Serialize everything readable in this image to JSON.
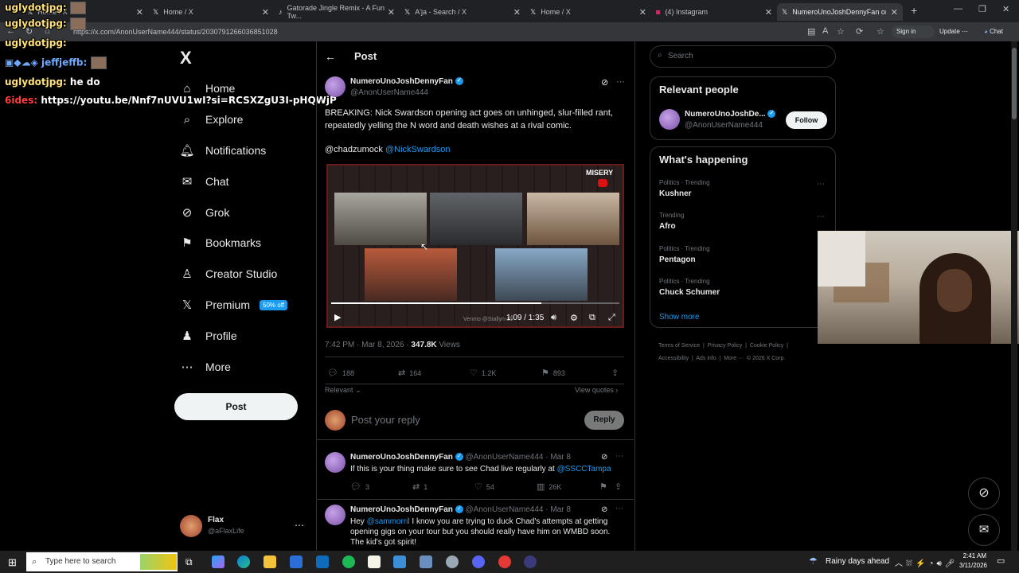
{
  "browser": {
    "tabs": [
      {
        "label": "Home / X",
        "active": false
      },
      {
        "label": "Home / X",
        "active": false
      },
      {
        "label": "Gatorade Jingle Remix - A Fun Tw...",
        "active": false
      },
      {
        "label": "A'ja - Search / X",
        "active": false
      },
      {
        "label": "Home / X",
        "active": false
      },
      {
        "label": "(4) Instagram",
        "active": false
      },
      {
        "label": "NumeroUnoJoshDennyFan on X: \"",
        "active": true
      }
    ],
    "url": "https://x.com/AnonUserName444/status/2030791266036851028",
    "sign_in": "Sign in",
    "update": "Update",
    "chat": "Chat"
  },
  "overlay_chat": [
    {
      "name": "uglydotjpg:",
      "text": "",
      "style": "name"
    },
    {
      "name": "uglydotjpg:",
      "text": "",
      "style": "name"
    },
    {
      "name": "jeffjeffb:",
      "text": "",
      "style": "blue"
    },
    {
      "name": "uglydotjpg:",
      "text": "he do",
      "style": "name"
    },
    {
      "name": "6ides:",
      "text": "https://youtu.be/Nnf7nUVU1wI?si=RCSXZgU3I-pHQWjP",
      "style": "red"
    }
  ],
  "nav": {
    "logo": "X",
    "items": [
      {
        "label": "Home",
        "icon": "home-icon",
        "glyph": "⌂"
      },
      {
        "label": "Explore",
        "icon": "search-icon",
        "glyph": "⌕"
      },
      {
        "label": "Notifications",
        "icon": "bell-icon",
        "glyph": "🔔︎"
      },
      {
        "label": "Chat",
        "icon": "mail-icon",
        "glyph": "✉"
      },
      {
        "label": "Grok",
        "icon": "grok-icon",
        "glyph": "⊘"
      },
      {
        "label": "Bookmarks",
        "icon": "bookmark-icon",
        "glyph": "⚑"
      },
      {
        "label": "Creator Studio",
        "icon": "creator-icon",
        "glyph": "♙"
      },
      {
        "label": "Premium",
        "icon": "x-premium-icon",
        "glyph": "𝕏",
        "badge": "50% off"
      },
      {
        "label": "Profile",
        "icon": "profile-icon",
        "glyph": "♟"
      },
      {
        "label": "More",
        "icon": "more-icon",
        "glyph": "⋯"
      }
    ],
    "post_button": "Post",
    "account": {
      "name": "Flax",
      "handle": "@aFlaxLife"
    }
  },
  "post": {
    "header": "Post",
    "author": "NumeroUnoJoshDennyFan",
    "handle": "@AnonUserName444",
    "text": "BREAKING: Nick Swardson opening act goes on unhinged, slur-filled rant, repeatedly yelling the N word and death wishes at a rival comic.",
    "mention1": "@chadzumock",
    "mention2": "@NickSwardson",
    "video": {
      "time": "1:09 / 1:35",
      "progress": 0.73,
      "watermark": "Venmo @Stallyn-19",
      "show_label": "MISERY"
    },
    "timestamp": "7:42 PM · Mar 8, 2026 · ",
    "views_count": "347.8K",
    "views_label": " Views",
    "replies": "188",
    "reposts": "164",
    "likes": "1.2K",
    "bookmarks": "893",
    "relevant": "Relevant",
    "view_quotes": "View quotes",
    "reply_placeholder": "Post your reply",
    "reply_button": "Reply"
  },
  "replies": [
    {
      "author": "NumeroUnoJoshDennyFan",
      "meta": "@AnonUserName444 · Mar 8",
      "text_pre": "If this is your thing make sure to see Chad live regularly at ",
      "link": "@SSCCTampa",
      "text_post": "",
      "replies": "3",
      "reposts": "1",
      "likes": "54",
      "views": "26K"
    },
    {
      "author": "NumeroUnoJoshDennyFan",
      "meta": "@AnonUserName444 · Mar 8",
      "text_pre": "Hey ",
      "link": "@sammorril",
      "text_post": " I know you are trying to duck Chad's attempts at getting opening gigs on your tour but you should really have him on WMBD soon. The kid's got spirit!"
    }
  ],
  "sidebar": {
    "search_placeholder": "Search",
    "relevant_title": "Relevant people",
    "person": {
      "name": "NumeroUnoJoshDe...",
      "handle": "@AnonUserName444",
      "follow": "Follow"
    },
    "happening_title": "What's happening",
    "trends": [
      {
        "category": "Politics · Trending",
        "name": "Kushner"
      },
      {
        "category": "Trending",
        "name": "Afro"
      },
      {
        "category": "Politics · Trending",
        "name": "Pentagon"
      },
      {
        "category": "Politics · Trending",
        "name": "Chuck Schumer"
      }
    ],
    "show_more": "Show more",
    "footer_line1": "Terms of Service  |  Privacy Policy  |  Cookie Policy  |",
    "footer_line2": "Accessibility  |  Ads info  |  More ···  © 2026 X Corp."
  },
  "taskbar": {
    "search_placeholder": "Type here to search",
    "weather": "Rainy days ahead",
    "time": "2:41 AM",
    "date": "3/11/2026"
  },
  "colors": {
    "accent": "#1d9bf0",
    "background": "#000000",
    "border": "#2f3336",
    "muted": "#71767b"
  }
}
